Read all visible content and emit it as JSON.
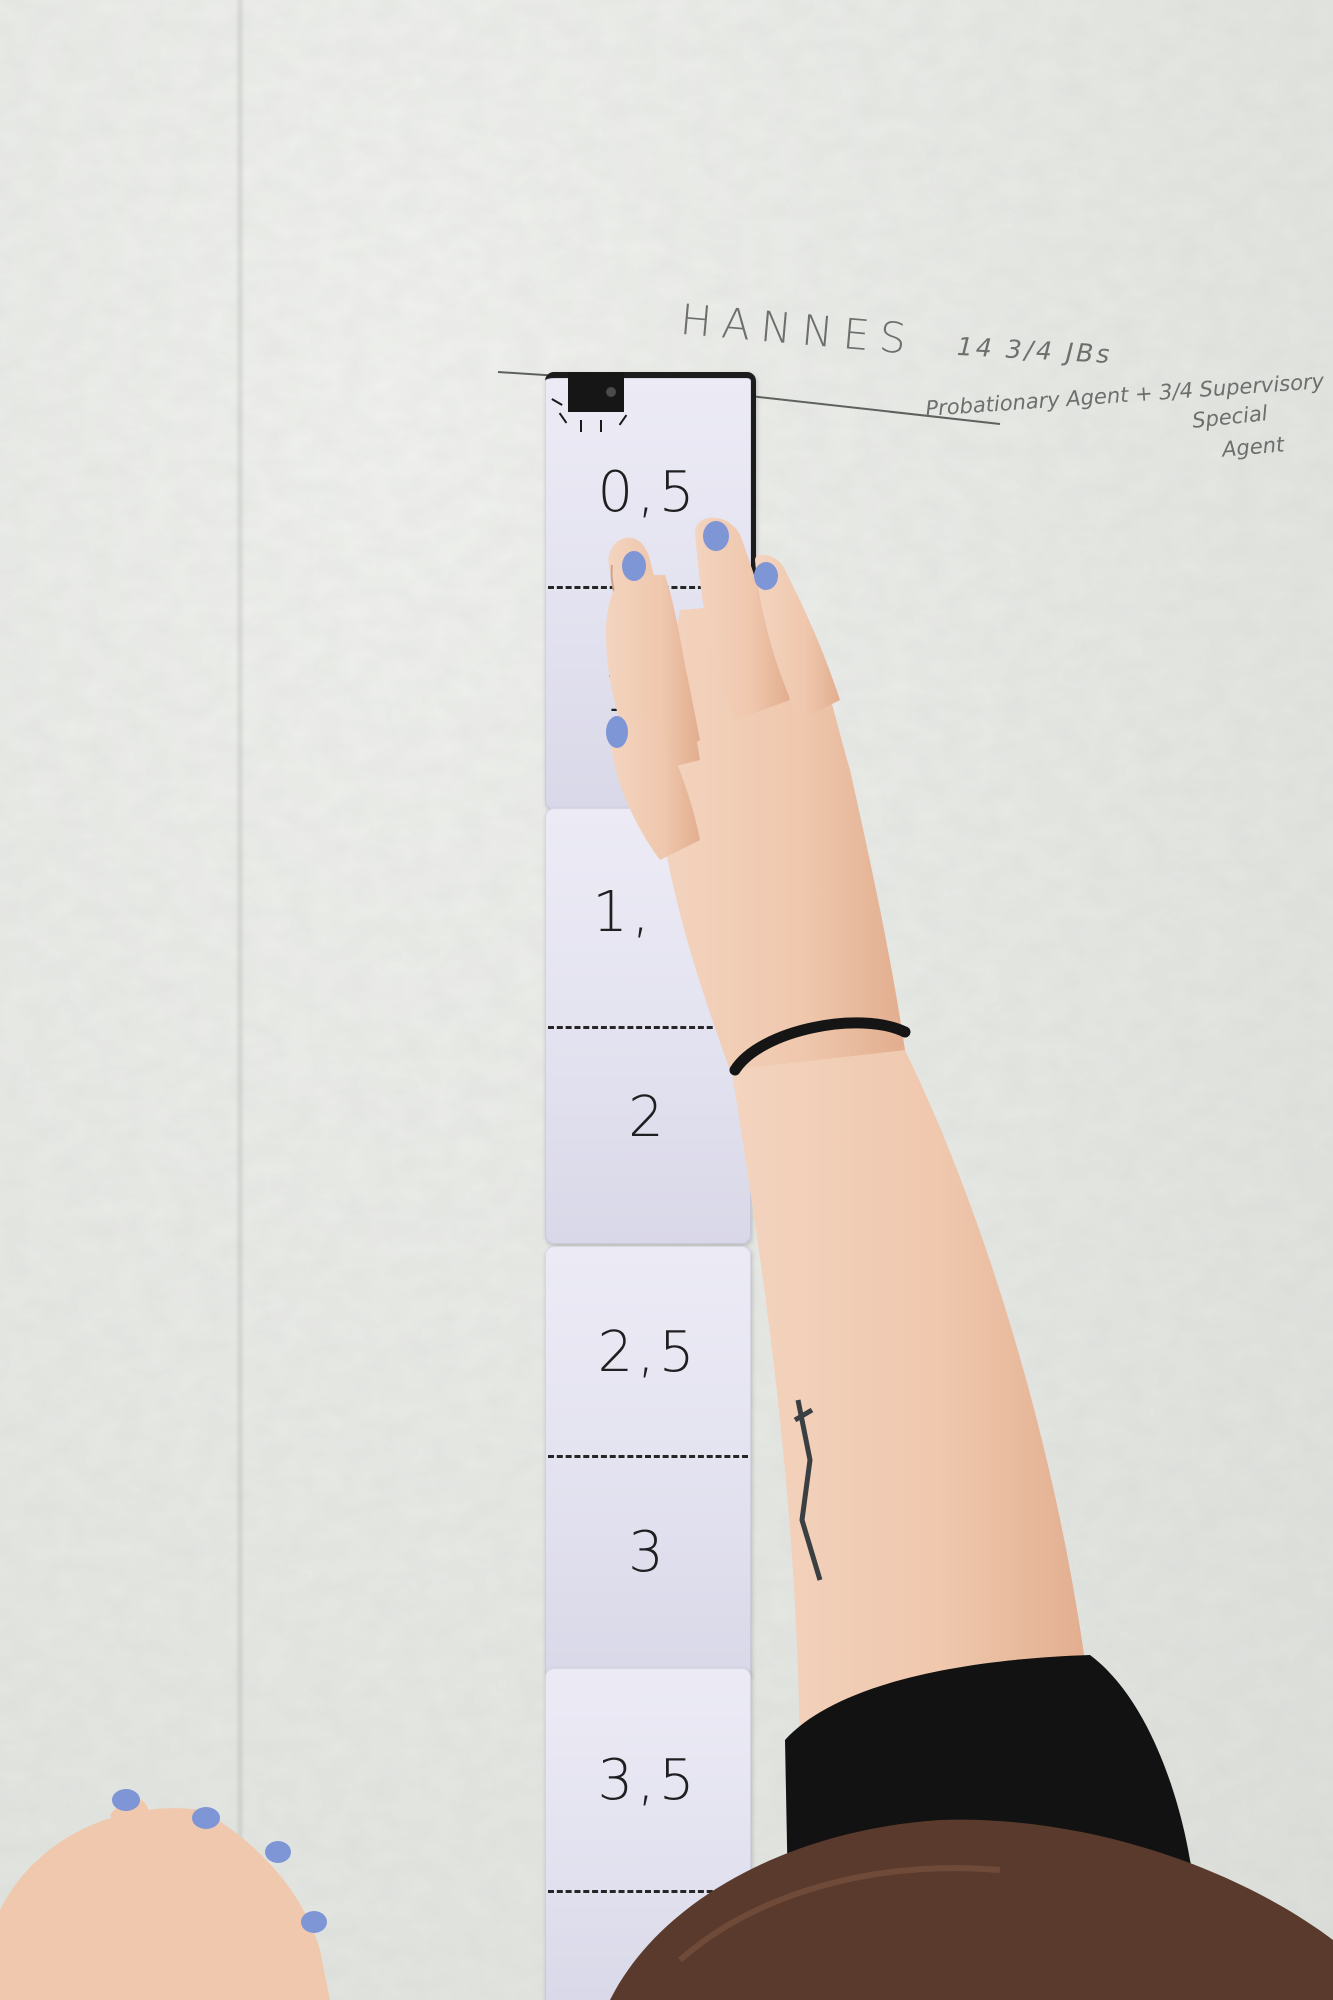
{
  "image": {
    "wall_color": "#e9ebe8",
    "card_color": "#e4e3f0",
    "nail_color": "#7e95d6",
    "skin_color": "#f1cdb4"
  },
  "wall_writing": {
    "name": "HANNES",
    "age": "14 3/4 JBs",
    "role_line1": "Probationary Agent + 3/4 Supervisory",
    "role_line2": "Special",
    "role_line3": "Agent"
  },
  "measure_strip": {
    "segments": [
      "0,5",
      "1",
      "1,",
      "2",
      "2,5",
      "3",
      "3,5"
    ]
  },
  "icons": {
    "top_mark": "camera-icon"
  }
}
